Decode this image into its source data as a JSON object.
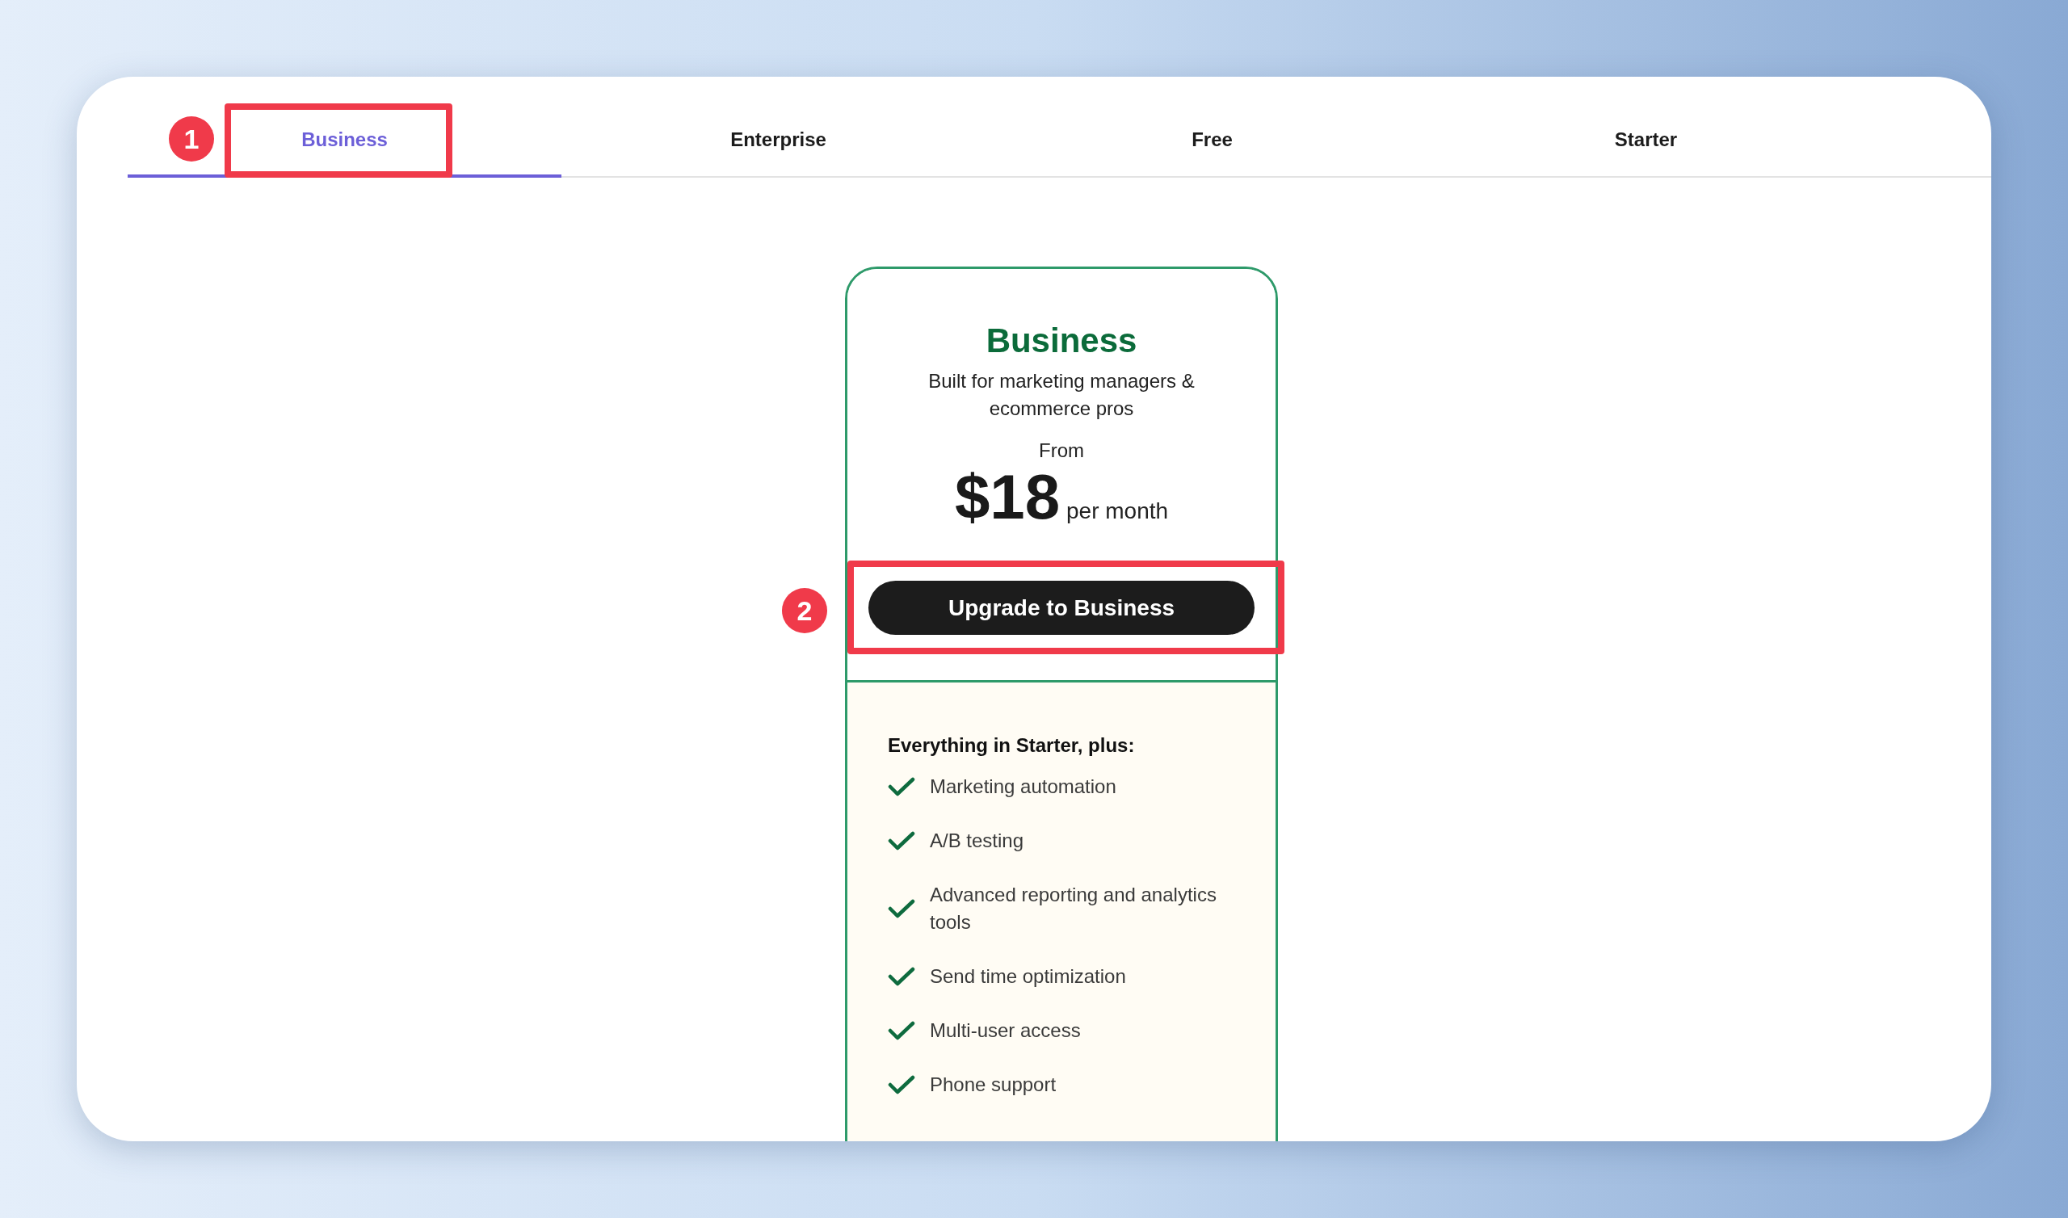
{
  "tabs": [
    {
      "label": "Business",
      "selected": true
    },
    {
      "label": "Enterprise",
      "selected": false
    },
    {
      "label": "Free",
      "selected": false
    },
    {
      "label": "Starter",
      "selected": false
    }
  ],
  "plan": {
    "name": "Business",
    "tagline": "Built for marketing managers & ecommerce pros",
    "price_prefix": "From",
    "price": "$18",
    "price_unit": "per month",
    "button": "Upgrade to Business",
    "features_heading": "Everything in Starter, plus:",
    "features": [
      "Marketing automation",
      "A/B testing",
      "Advanced reporting and analytics tools",
      "Send time optimization",
      "Multi-user access",
      "Phone support"
    ]
  },
  "annotations": [
    {
      "number": "1",
      "kind": "tab"
    },
    {
      "number": "2",
      "kind": "button"
    }
  ]
}
